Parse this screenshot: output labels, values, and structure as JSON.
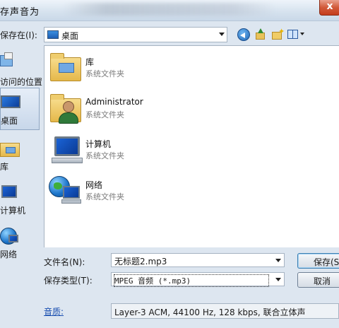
{
  "window": {
    "title": "存声音为",
    "close_label": "x"
  },
  "toolbar": {
    "save_in_label": "保存在(I):",
    "location_value": "桌面"
  },
  "places": [
    {
      "label": "访问的位置",
      "selected": false
    },
    {
      "label": "桌面",
      "selected": true
    },
    {
      "label": "库",
      "selected": false
    },
    {
      "label": "计算机",
      "selected": false
    },
    {
      "label": "网络",
      "selected": false
    }
  ],
  "files": [
    {
      "name": "库",
      "type": "系统文件夹",
      "icon": "library-icon"
    },
    {
      "name": "Administrator",
      "type": "系统文件夹",
      "icon": "user-folder-icon"
    },
    {
      "name": "计算机",
      "type": "系统文件夹",
      "icon": "computer-icon"
    },
    {
      "name": "网络",
      "type": "系统文件夹",
      "icon": "network-icon"
    }
  ],
  "form": {
    "filename_label": "文件名(N):",
    "filename_value": "无标题2.mp3",
    "filetype_label": "保存类型(T):",
    "filetype_value": "MPEG 音频 (*.mp3)",
    "quality_label": "音质:",
    "quality_value": "Layer-3 ACM, 44100 Hz, 128 kbps, 联合立体声"
  },
  "buttons": {
    "save_label": "保存(S)",
    "cancel_label": "取消"
  }
}
